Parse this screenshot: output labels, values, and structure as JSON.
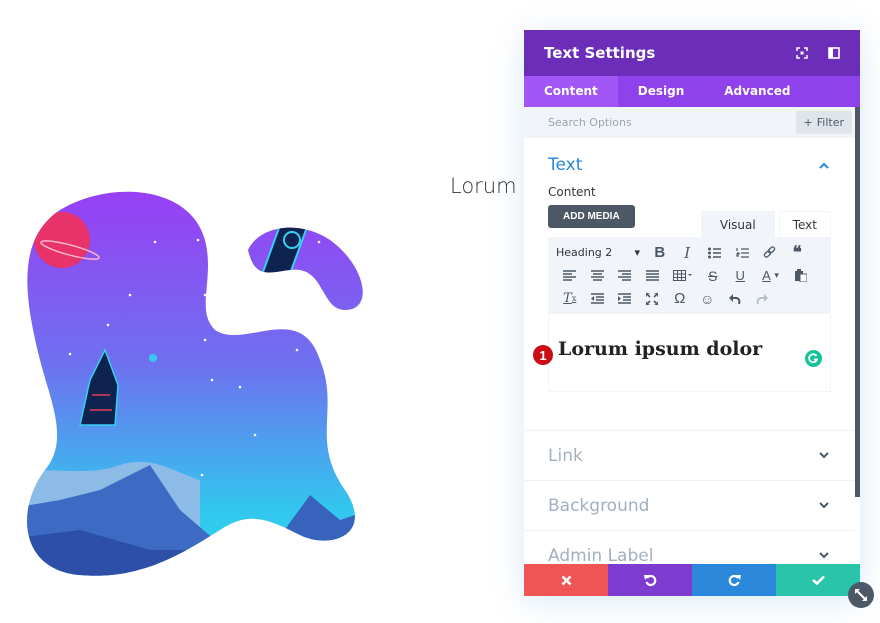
{
  "page": {
    "background_text": "Lorum i",
    "illustration": "blob-shaped space scene: planet, rockets, stars, mountains"
  },
  "panel": {
    "title": "Text Settings",
    "header_icons": [
      "focus-icon",
      "sidebar-toggle-icon"
    ],
    "tabs": [
      {
        "label": "Content",
        "active": true
      },
      {
        "label": "Design",
        "active": false
      },
      {
        "label": "Advanced",
        "active": false
      }
    ],
    "search": {
      "placeholder": "Search Options"
    },
    "filter_label": "Filter",
    "sections": {
      "text": {
        "title": "Text",
        "content_label": "Content",
        "add_media": "ADD MEDIA",
        "mode_tabs": [
          "Visual",
          "Text"
        ],
        "format_select": "Heading 2",
        "editor_content": "Lorum ipsum dolor",
        "badge": "1"
      },
      "collapsed": [
        {
          "title": "Link"
        },
        {
          "title": "Background"
        },
        {
          "title": "Admin Label"
        }
      ]
    },
    "toolbar": {
      "row1": [
        "bold-icon",
        "italic-icon",
        "bulleted-list-icon",
        "numbered-list-icon",
        "link-icon",
        "blockquote-icon"
      ],
      "row2": [
        "align-left-icon",
        "align-center-icon",
        "align-right-icon",
        "justify-icon",
        "table-icon",
        "strikethrough-icon",
        "underline-icon",
        "text-color-icon",
        "paste-text-icon"
      ],
      "row3": [
        "clear-formatting-icon",
        "outdent-icon",
        "indent-icon",
        "fullscreen-icon",
        "special-character-icon",
        "emoji-icon",
        "undo-icon",
        "redo-icon"
      ]
    },
    "footer": {
      "buttons": [
        {
          "name": "cancel",
          "color": "#ef5555"
        },
        {
          "name": "undo",
          "color": "#7e3bd0"
        },
        {
          "name": "redo",
          "color": "#2b87da"
        },
        {
          "name": "save",
          "color": "#29c4a9"
        }
      ]
    }
  },
  "colors": {
    "header": "#6c2eb9",
    "tabs": "#8f42ec",
    "accent_blue": "#2b87da",
    "dark_gray": "#4c5866"
  }
}
